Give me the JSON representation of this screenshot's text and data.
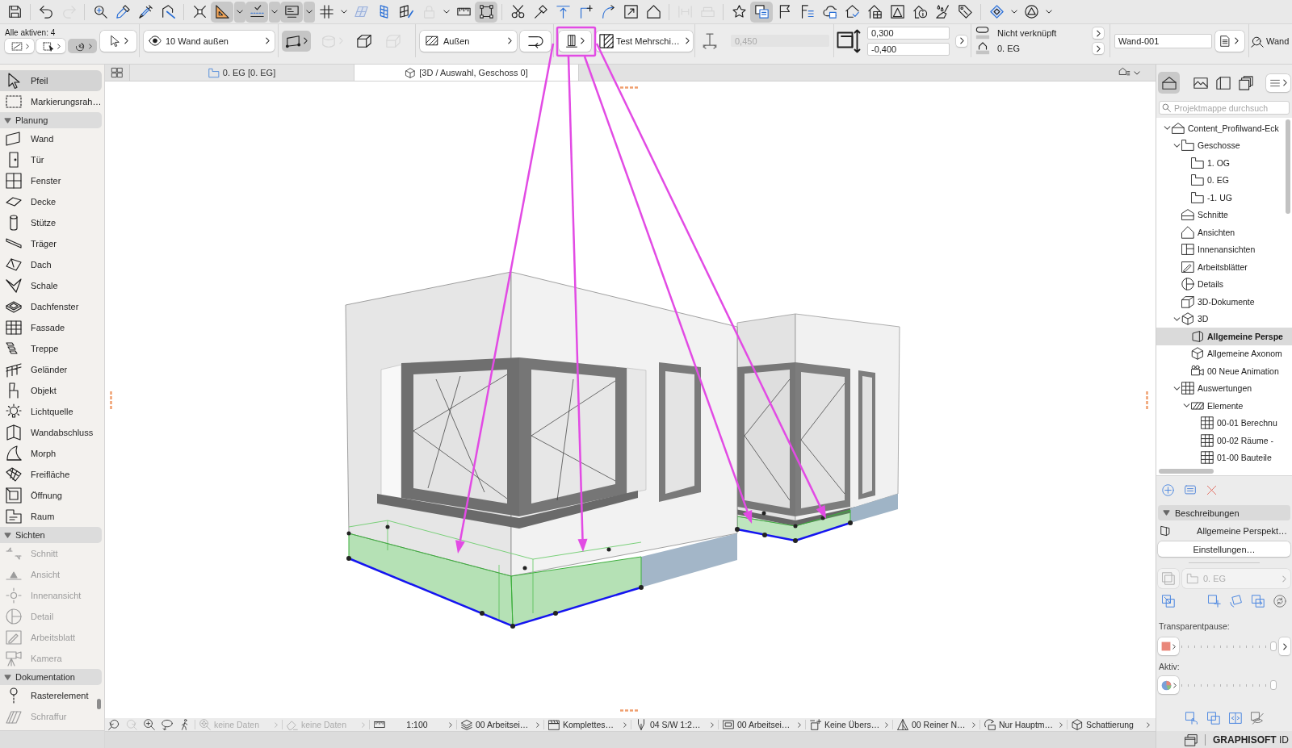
{
  "toolbar": {
    "groups": [
      [
        {
          "kind": "save",
          "on": false,
          "disabled": false,
          "dropdown": false
        }
      ],
      [
        {
          "kind": "undo",
          "on": false,
          "disabled": false,
          "dropdown": false
        },
        {
          "kind": "redo",
          "on": false,
          "disabled": true,
          "dropdown": false
        }
      ],
      [
        {
          "kind": "find",
          "on": false,
          "disabled": false,
          "dropdown": false
        },
        {
          "kind": "eyedropper",
          "on": false,
          "disabled": false,
          "dropdown": false
        },
        {
          "kind": "syringe",
          "on": false,
          "disabled": false,
          "dropdown": false
        },
        {
          "kind": "polygon",
          "on": false,
          "disabled": false,
          "dropdown": false
        }
      ],
      [
        {
          "kind": "crossed",
          "on": false,
          "disabled": false,
          "dropdown": false
        },
        {
          "kind": "setsquare",
          "on": true,
          "disabled": false,
          "dropdown": true
        },
        {
          "kind": "guide",
          "on": true,
          "disabled": false,
          "dropdown": true
        },
        {
          "kind": "coordinate",
          "on": true,
          "disabled": false,
          "dropdown": true
        },
        {
          "kind": "grid",
          "on": false,
          "disabled": false,
          "dropdown": true
        },
        {
          "kind": "planegrid",
          "on": false,
          "disabled": true,
          "dropdown": false
        },
        {
          "kind": "slanted",
          "on": false,
          "disabled": false,
          "dropdown": false
        },
        {
          "kind": "gridpencil",
          "on": false,
          "disabled": false,
          "dropdown": false
        },
        {
          "kind": "padlock",
          "on": false,
          "disabled": true,
          "dropdown": true
        },
        {
          "kind": "ruler",
          "on": false,
          "disabled": false,
          "dropdown": false
        },
        {
          "kind": "selframe",
          "on": true,
          "disabled": false,
          "dropdown": false
        }
      ],
      [
        {
          "kind": "scissors",
          "on": false,
          "disabled": false,
          "dropdown": false
        },
        {
          "kind": "hammer",
          "on": false,
          "disabled": false,
          "dropdown": false
        },
        {
          "kind": "aligntop",
          "on": false,
          "disabled": false,
          "dropdown": false
        },
        {
          "kind": "corner",
          "on": false,
          "disabled": false,
          "dropdown": false
        },
        {
          "kind": "curve",
          "on": false,
          "disabled": false,
          "dropdown": false
        },
        {
          "kind": "resize",
          "on": false,
          "disabled": false,
          "dropdown": false
        },
        {
          "kind": "house",
          "on": false,
          "disabled": false,
          "dropdown": false
        }
      ],
      [
        {
          "kind": "distribute",
          "on": false,
          "disabled": true,
          "dropdown": false
        },
        {
          "kind": "bracket",
          "on": false,
          "disabled": true,
          "dropdown": false
        }
      ],
      [
        {
          "kind": "star",
          "on": false,
          "disabled": false,
          "dropdown": false
        },
        {
          "kind": "stackwin",
          "on": true,
          "disabled": false,
          "dropdown": false
        },
        {
          "kind": "flag",
          "on": false,
          "disabled": false,
          "dropdown": false
        },
        {
          "kind": "list",
          "on": false,
          "disabled": false,
          "dropdown": false
        },
        {
          "kind": "cloud",
          "on": false,
          "disabled": false,
          "dropdown": false
        },
        {
          "kind": "housecheck",
          "on": false,
          "disabled": false,
          "dropdown": false
        },
        {
          "kind": "housegrid",
          "on": false,
          "disabled": false,
          "dropdown": false
        },
        {
          "kind": "framedtri",
          "on": false,
          "disabled": false,
          "dropdown": false
        },
        {
          "kind": "houseinfo",
          "on": false,
          "disabled": false,
          "dropdown": false
        },
        {
          "kind": "brush",
          "on": false,
          "disabled": false,
          "dropdown": false
        },
        {
          "kind": "tag",
          "on": false,
          "disabled": false,
          "dropdown": false
        }
      ],
      [
        {
          "kind": "rhombus",
          "on": false,
          "disabled": false,
          "dropdown": true
        },
        {
          "kind": "circtri",
          "on": false,
          "disabled": false,
          "dropdown": true
        }
      ]
    ]
  },
  "info_box": {
    "active_count": "Alle aktiven: 4",
    "selection_modes": [
      {
        "kind": "box",
        "on": false
      },
      {
        "kind": "frame",
        "on": false
      },
      {
        "kind": "spiral",
        "on": true
      }
    ],
    "layer": "10 Wand außen",
    "geometry_methods": [
      {
        "kind": "straight",
        "on": true,
        "disabled": false,
        "dropdown": true
      },
      {
        "kind": "curved",
        "on": false,
        "disabled": true,
        "dropdown": true
      },
      {
        "kind": "trapezoid",
        "on": false,
        "disabled": false,
        "dropdown": false
      },
      {
        "kind": "polygonal",
        "on": false,
        "disabled": true,
        "dropdown": false
      }
    ],
    "reference_line": "Außen",
    "composite": "Test Mehrschi…",
    "height": {
      "value": "0,450",
      "disabled": true
    },
    "offsets": [
      "0,300",
      "-0,400"
    ],
    "top_link": "Nicht verknüpft",
    "home_story": "0. EG",
    "element_id": "Wand-001",
    "tool": "Wand"
  },
  "annotation": {
    "highlight_frame": true,
    "arrows": true
  },
  "tabs": [
    {
      "label": "0. EG [0. EG]",
      "kind": "plan",
      "selected": false
    },
    {
      "label": "[3D / Auswahl, Geschoss 0]",
      "kind": "model",
      "selected": true
    }
  ],
  "toolbox": {
    "top": [
      {
        "label": "Pfeil",
        "kind": "arrow",
        "selected": true,
        "disabled": false
      },
      {
        "label": "Markierungsrah…",
        "kind": "marquee",
        "selected": false,
        "disabled": false
      }
    ],
    "sections": [
      {
        "title": "Planung",
        "expanded": true,
        "items": [
          {
            "label": "Wand",
            "kind": "wall",
            "selected": false,
            "disabled": false
          },
          {
            "label": "Tür",
            "kind": "door",
            "selected": false,
            "disabled": false
          },
          {
            "label": "Fenster",
            "kind": "window",
            "selected": false,
            "disabled": false
          },
          {
            "label": "Decke",
            "kind": "slab",
            "selected": false,
            "disabled": false
          },
          {
            "label": "Stütze",
            "kind": "column",
            "selected": false,
            "disabled": false
          },
          {
            "label": "Träger",
            "kind": "beam",
            "selected": false,
            "disabled": false
          },
          {
            "label": "Dach",
            "kind": "roof",
            "selected": false,
            "disabled": false
          },
          {
            "label": "Schale",
            "kind": "shell",
            "selected": false,
            "disabled": false
          },
          {
            "label": "Dachfenster",
            "kind": "skylight",
            "selected": false,
            "disabled": false
          },
          {
            "label": "Fassade",
            "kind": "curtain",
            "selected": false,
            "disabled": false
          },
          {
            "label": "Treppe",
            "kind": "stair",
            "selected": false,
            "disabled": false
          },
          {
            "label": "Geländer",
            "kind": "railing",
            "selected": false,
            "disabled": false
          },
          {
            "label": "Objekt",
            "kind": "object",
            "selected": false,
            "disabled": false
          },
          {
            "label": "Lichtquelle",
            "kind": "lamp",
            "selected": false,
            "disabled": false
          },
          {
            "label": "Wandabschluss",
            "kind": "wallend",
            "selected": false,
            "disabled": false
          },
          {
            "label": "Morph",
            "kind": "morph",
            "selected": false,
            "disabled": false
          },
          {
            "label": "Freifläche",
            "kind": "mesh",
            "selected": false,
            "disabled": false
          },
          {
            "label": "Öffnung",
            "kind": "opening",
            "selected": false,
            "disabled": false
          },
          {
            "label": "Raum",
            "kind": "zone",
            "selected": false,
            "disabled": false
          }
        ]
      },
      {
        "title": "Sichten",
        "expanded": true,
        "items": [
          {
            "label": "Schnitt",
            "kind": "section",
            "selected": false,
            "disabled": true
          },
          {
            "label": "Ansicht",
            "kind": "elevation",
            "selected": false,
            "disabled": true
          },
          {
            "label": "Innenansicht",
            "kind": "interior",
            "selected": false,
            "disabled": true
          },
          {
            "label": "Detail",
            "kind": "detail",
            "selected": false,
            "disabled": true
          },
          {
            "label": "Arbeitsblatt",
            "kind": "worksheet",
            "selected": false,
            "disabled": true
          },
          {
            "label": "Kamera",
            "kind": "camera",
            "selected": false,
            "disabled": true
          }
        ]
      },
      {
        "title": "Dokumentation",
        "expanded": true,
        "items": [
          {
            "label": "Rasterelement",
            "kind": "gridline",
            "selected": false,
            "disabled": false
          },
          {
            "label": "Schraffur",
            "kind": "fill",
            "selected": false,
            "disabled": true
          }
        ]
      }
    ]
  },
  "status_bar": {
    "navigation": [
      {
        "kind": "zoom-back",
        "disabled": false
      },
      {
        "kind": "zoom-forward",
        "disabled": true
      },
      {
        "kind": "zoom-in",
        "disabled": false
      },
      {
        "kind": "orbit",
        "disabled": false
      },
      {
        "kind": "walk",
        "disabled": false
      }
    ],
    "items": [
      {
        "kind": "fit",
        "label": "keine Daten",
        "disabled": true
      },
      {
        "kind": "eraser",
        "label": "keine Daten",
        "disabled": true
      },
      {
        "kind": "scale",
        "label": "1:100",
        "disabled": false
      },
      {
        "kind": "layers",
        "label": "00 Arbeitsei…",
        "disabled": false
      },
      {
        "kind": "clapper",
        "label": "Komplettes…",
        "disabled": false
      },
      {
        "kind": "pen",
        "label": "04 S/W 1:2…",
        "disabled": false
      },
      {
        "kind": "frame",
        "label": "00 Arbeitsei…",
        "disabled": false
      },
      {
        "kind": "override",
        "label": "Keine Übers…",
        "disabled": false
      },
      {
        "kind": "renovation",
        "label": "00 Reiner N…",
        "disabled": false
      },
      {
        "kind": "structure",
        "label": "Nur Hauptm…",
        "disabled": false
      },
      {
        "kind": "cube",
        "label": "Schattierung",
        "disabled": false
      }
    ]
  },
  "navigator": {
    "modes": [
      {
        "kind": "project",
        "selected": true
      },
      {
        "kind": "layout",
        "selected": false
      },
      {
        "kind": "publisher",
        "selected": false
      },
      {
        "kind": "organizer",
        "selected": false
      }
    ],
    "search": {
      "placeholder": "Projektmappe durchsuch"
    },
    "tree": [
      {
        "label": "Content_Profilwand-Eck",
        "kind": "project",
        "expanded": true,
        "selected": false,
        "children": [
          {
            "label": "Geschosse",
            "kind": "stories",
            "expanded": true,
            "selected": false,
            "children": [
              {
                "label": "1. OG",
                "kind": "story",
                "selected": false
              },
              {
                "label": "0. EG",
                "kind": "story",
                "selected": false
              },
              {
                "label": "-1. UG",
                "kind": "story",
                "selected": false
              }
            ]
          },
          {
            "label": "Schnitte",
            "kind": "sections",
            "selected": false
          },
          {
            "label": "Ansichten",
            "kind": "elevations",
            "selected": false
          },
          {
            "label": "Innenansichten",
            "kind": "interior",
            "selected": false
          },
          {
            "label": "Arbeitsblätter",
            "kind": "worksheets",
            "selected": false
          },
          {
            "label": "Details",
            "kind": "details",
            "selected": false
          },
          {
            "label": "3D-Dokumente",
            "kind": "documents",
            "selected": false
          },
          {
            "label": "3D",
            "kind": "model",
            "expanded": true,
            "selected": false,
            "children": [
              {
                "label": "Allgemeine Perspe",
                "kind": "perspective",
                "selected": true
              },
              {
                "label": "Allgemeine Axonom",
                "kind": "axonometry",
                "selected": false
              },
              {
                "label": "00 Neue Animation",
                "kind": "animation",
                "selected": false
              }
            ]
          },
          {
            "label": "Auswertungen",
            "kind": "schedules",
            "expanded": true,
            "selected": false,
            "children": [
              {
                "label": "Elemente",
                "kind": "elements",
                "expanded": true,
                "selected": false,
                "children": [
                  {
                    "label": "00-01 Berechnu",
                    "kind": "schedule",
                    "selected": false
                  },
                  {
                    "label": "00-02 Räume -",
                    "kind": "schedule",
                    "selected": false
                  },
                  {
                    "label": "01-00 Bauteile",
                    "kind": "schedule",
                    "selected": false
                  }
                ]
              }
            ]
          }
        ]
      }
    ],
    "properties": {
      "title": "Beschreibungen",
      "expanded": true,
      "view_name": "Allgemeine Perspekt…",
      "settings_button": "Einstellungen…",
      "story": {
        "label": "0. EG",
        "disabled": true
      }
    },
    "transparency": {
      "label": "Transparentpause:",
      "level": 1
    },
    "active": {
      "label": "Aktiv:",
      "level": 1
    },
    "footer": "**GRAPHISOFT** ID"
  }
}
